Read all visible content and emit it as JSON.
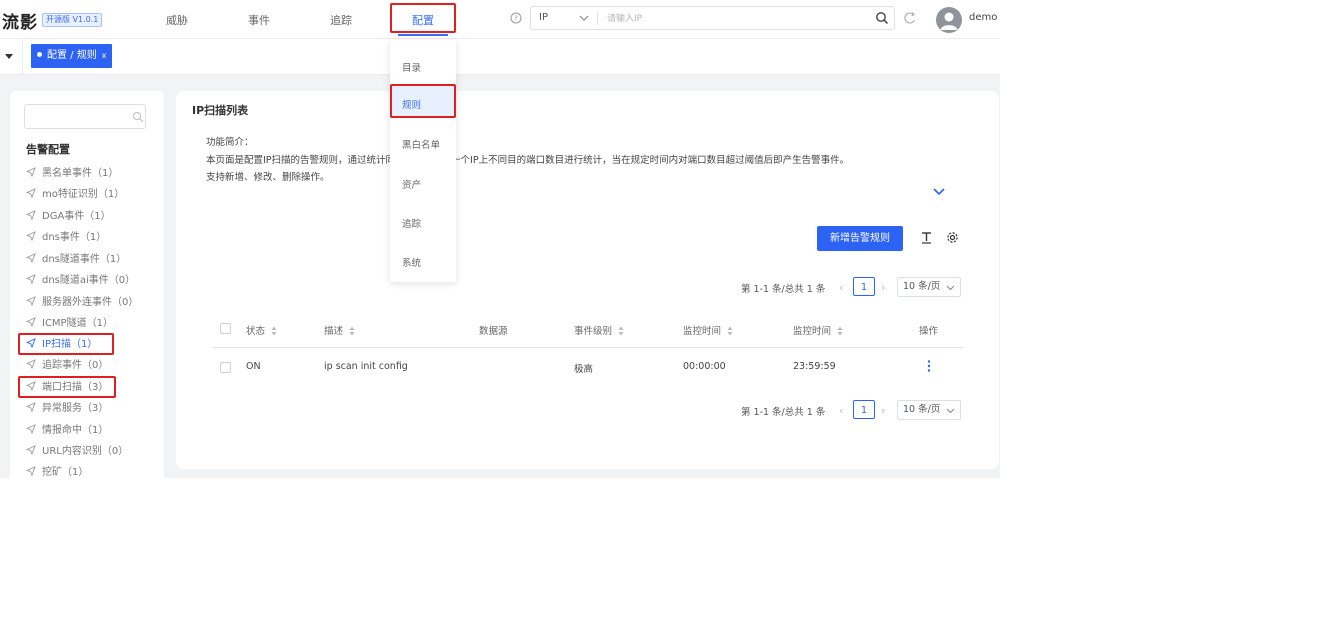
{
  "header": {
    "logo": "流影",
    "version": "开源版 V1.0.1",
    "nav": [
      "威胁",
      "事件",
      "追踪",
      "配置"
    ],
    "active_nav": "配置",
    "search_type": "IP",
    "search_placeholder": "请输入IP",
    "username": "demo"
  },
  "tabs": {
    "active_tab": "配置 / 规则",
    "close": "x"
  },
  "sidebar": {
    "search_placeholder": "",
    "title": "告警配置",
    "items": [
      "黑名单事件（1）",
      "mo特征识别（1）",
      "DGA事件（1）",
      "dns事件（1）",
      "dns隧道事件（1）",
      "dns隧道ai事件（0）",
      "服务器外连事件（0）",
      "ICMP隧道（1）",
      "IP扫描（1）",
      "追踪事件（0）",
      "端口扫描（3）",
      "异常服务（3）",
      "情报命中（1）",
      "URL内容识别（0）",
      "挖矿（1）"
    ],
    "active_item": "IP扫描（1）"
  },
  "dropdown": {
    "items": [
      "目录",
      "规则",
      "黑白名单",
      "资产",
      "追踪",
      "系统"
    ],
    "active_item": "规则"
  },
  "main": {
    "title": "IP扫描列表",
    "intro_label": "功能简介：",
    "intro_line1": "本页面是配置IP扫描的告警规则，通过统计同一个源IP在同一个IP上不同目的端口数目进行统计，当在规定时间内对端口数目超过阈值后即产生告警事件。",
    "intro_line2": "支持新增、修改、删除操作。",
    "add_button": "新增告警规则",
    "pagination": {
      "total": "第 1-1 条/总共 1 条",
      "page": "1",
      "page_size": "10 条/页"
    },
    "columns": [
      "状态",
      "描述",
      "数据源",
      "事件级别",
      "监控时间",
      "监控时间",
      "操作"
    ],
    "rows": [
      {
        "status": "ON",
        "description": "ip scan init config",
        "source": "",
        "level": "极高",
        "start_time": "00:00:00",
        "end_time": "23:59:59"
      }
    ]
  },
  "colors": {
    "primary": "#2d63f5",
    "highlight": "#e02020",
    "background": "#f2f3f5"
  }
}
